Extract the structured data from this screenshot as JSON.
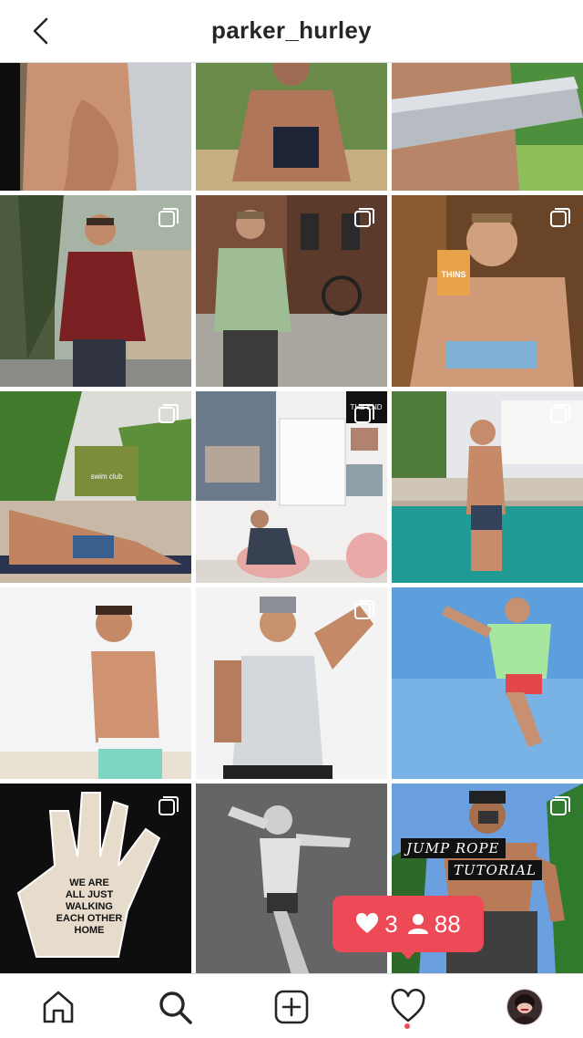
{
  "header": {
    "title": "parker_hurley"
  },
  "grid": {
    "tiles": [
      {
        "id": "post-1",
        "multi": false,
        "overlay": []
      },
      {
        "id": "post-2",
        "multi": false,
        "overlay": []
      },
      {
        "id": "post-3",
        "multi": false,
        "overlay": []
      },
      {
        "id": "post-4",
        "multi": true,
        "overlay": []
      },
      {
        "id": "post-5",
        "multi": true,
        "overlay": []
      },
      {
        "id": "post-6",
        "multi": true,
        "overlay": []
      },
      {
        "id": "post-7",
        "multi": true,
        "overlay": []
      },
      {
        "id": "post-8",
        "multi": true,
        "overlay": []
      },
      {
        "id": "post-9",
        "multi": true,
        "overlay": []
      },
      {
        "id": "post-10",
        "multi": false,
        "overlay": []
      },
      {
        "id": "post-11",
        "multi": true,
        "overlay": []
      },
      {
        "id": "post-12",
        "multi": false,
        "overlay": []
      },
      {
        "id": "post-13",
        "multi": true,
        "overlay": [
          "WE ARE",
          "ALL JUST",
          "WALKING",
          "EACH OTHER",
          "HOME"
        ]
      },
      {
        "id": "post-14",
        "multi": false,
        "overlay": []
      },
      {
        "id": "post-15",
        "multi": true,
        "overlay": [
          "JUMP ROPE",
          "TUTORIAL"
        ]
      }
    ],
    "signs": {
      "swim_club": "swim club",
      "thins": "THINS",
      "the_end": "THE END"
    }
  },
  "notification": {
    "likes": "3",
    "followers": "88"
  },
  "tabs": [
    "home",
    "search",
    "add",
    "activity",
    "profile"
  ],
  "colors": {
    "accent": "#ed4956",
    "text": "#262626",
    "divider": "#dbdbdb"
  }
}
